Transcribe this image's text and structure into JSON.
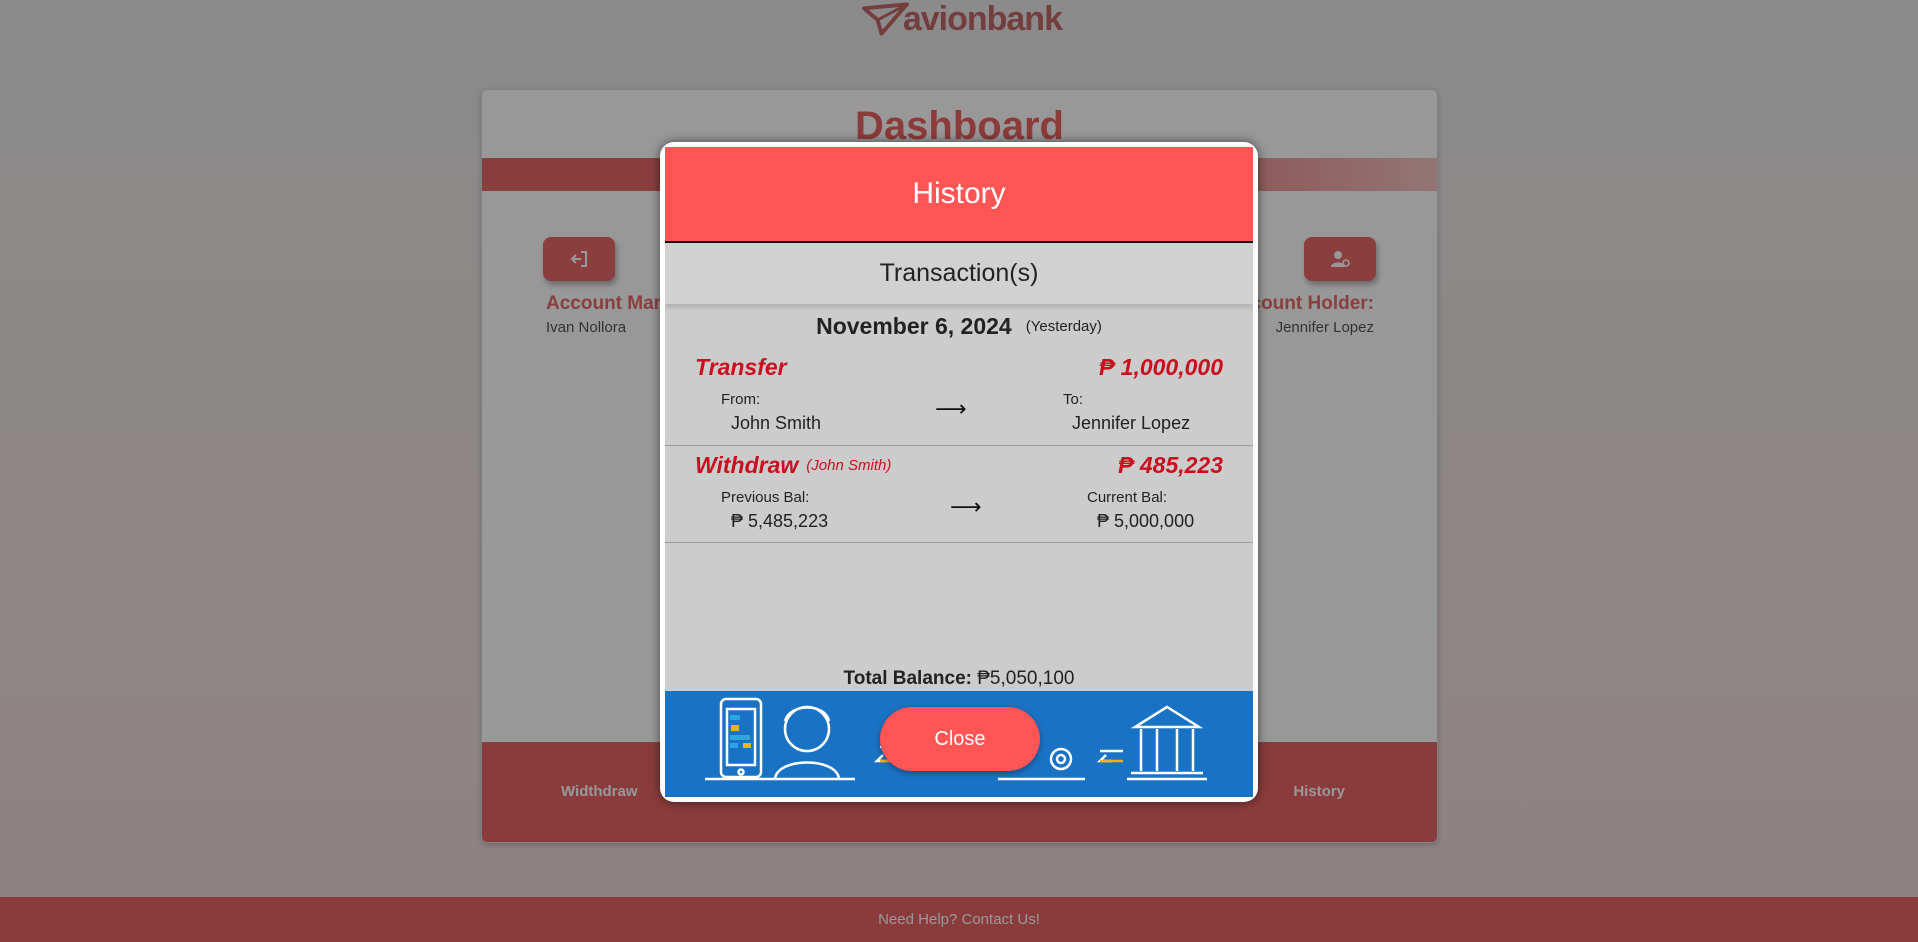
{
  "brand": {
    "name": "avionbank"
  },
  "dashboard": {
    "title": "Dashboard",
    "account_manager_label": "Account Manager:",
    "account_manager_name": "Ivan Nollora",
    "account_holder_label": "Account Holder:",
    "account_holder_name": "Jennifer Lopez",
    "logout_icon": "logout-icon",
    "user-settings_icon": "user-settings-icon",
    "nav": [
      "Widthdraw",
      "History"
    ]
  },
  "footer": {
    "text": "Need Help? Contact Us!"
  },
  "modal": {
    "title": "History",
    "subtitle": "Transaction(s)",
    "date": "November 6, 2024",
    "date_relative": "(Yesterday)",
    "transactions": [
      {
        "type": "Transfer",
        "amount": "₱ 1,000,000",
        "left_label": "From:",
        "left_value": "John Smith",
        "arrow": "⟶",
        "right_label": "To:",
        "right_value": "Jennifer Lopez"
      },
      {
        "type": "Withdraw",
        "who": "(John Smith)",
        "amount": "₱ 485,223",
        "left_label": "Previous Bal:",
        "left_value": "₱ 5,485,223",
        "arrow": "⟶",
        "right_label": "Current Bal:",
        "right_value": "₱ 5,000,000"
      }
    ],
    "total_label": "Total Balance:",
    "total_value": " ₱5,050,100",
    "close_label": "Close",
    "colors": {
      "header": "#ff5555",
      "accent": "#c9101e",
      "banner": "#1a72c4"
    }
  }
}
